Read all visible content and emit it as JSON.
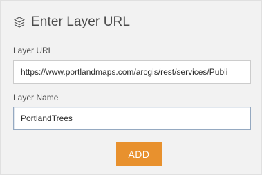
{
  "dialog": {
    "title": "Enter Layer URL",
    "icon": "layers-icon"
  },
  "fields": {
    "url_label": "Layer URL",
    "url_value": "https://www.portlandmaps.com/arcgis/rest/services/Publi",
    "name_label": "Layer Name",
    "name_value": "PortlandTrees"
  },
  "actions": {
    "add_label": "ADD"
  },
  "colors": {
    "accent": "#e8912e",
    "panel_bg": "#f2f2f2",
    "text": "#4c4c4c"
  }
}
